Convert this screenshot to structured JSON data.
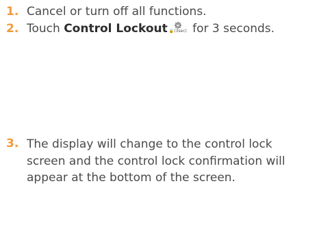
{
  "accent_color": "#f39a3c",
  "text_color": "#4a4a4a",
  "steps": [
    {
      "number": "1.",
      "text": "Cancel or turn off all functions."
    },
    {
      "number": "2.",
      "text_before": "Touch ",
      "bold": "Control Lockout",
      "icon": "gear-lock-icon",
      "icon_caption": "🔒(3sec)",
      "text_after": " for 3 seconds."
    },
    {
      "number": "3.",
      "text": "The display will change to the control lock screen and the control lock confirmation will appear at the bottom of the screen."
    }
  ]
}
